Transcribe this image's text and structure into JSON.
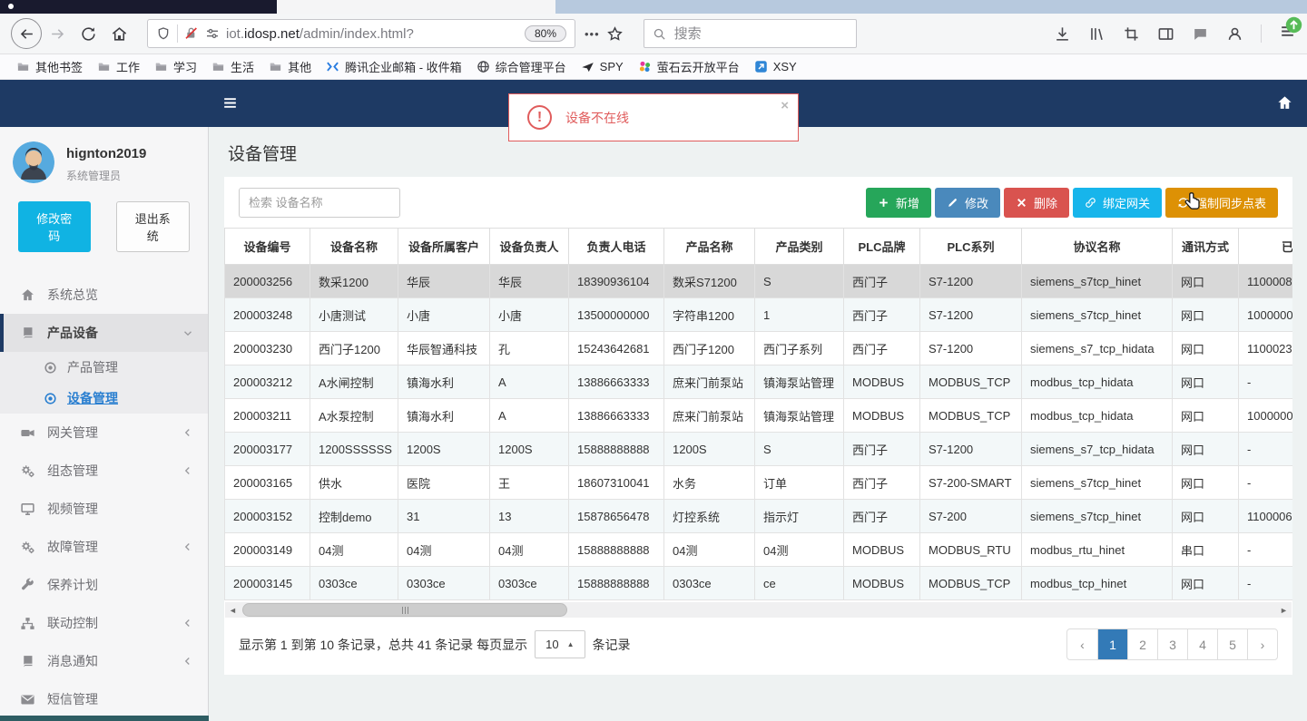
{
  "colors": {
    "navy": "#1e3a64",
    "cyan": "#10b3e3",
    "link": "#2a7fd0",
    "page-active": "#337ab7",
    "alert-red": "#e05c5c",
    "row-selected": "#d8d8d8",
    "row-stripe": "#f3f8f9"
  },
  "browser": {
    "url": {
      "pre": "iot.",
      "host": "idosp.net",
      "path": "/admin/index.html?"
    },
    "zoom_badge": "80%",
    "more_dots": "•••",
    "search_placeholder": "搜索",
    "bookmarks": [
      {
        "icon": "i-folder",
        "label": "其他书签"
      },
      {
        "icon": "i-folder",
        "label": "工作"
      },
      {
        "icon": "i-folder",
        "label": "学习"
      },
      {
        "icon": "i-folder",
        "label": "生活"
      },
      {
        "icon": "i-folder",
        "label": "其他"
      },
      {
        "icon": "fav-tencent",
        "label": "腾讯企业邮箱 - 收件箱"
      },
      {
        "icon": "fav-globe",
        "label": "综合管理平台"
      },
      {
        "icon": "fav-spy",
        "label": "SPY"
      },
      {
        "icon": "fav-ys7",
        "label": "萤石云开放平台"
      },
      {
        "icon": "fav-xsy",
        "label": "XSY"
      }
    ]
  },
  "alert": {
    "text": "设备不在线",
    "close": "×"
  },
  "sidebar": {
    "user": {
      "name": "hignton2019",
      "role": "系统管理员"
    },
    "buttons": {
      "change_password": "修改密码",
      "logout": "退出系统"
    },
    "menu": [
      {
        "id": "system-overview",
        "icon": "i-home-fill",
        "label": "系统总览"
      },
      {
        "id": "product-device",
        "icon": "i-book",
        "label": "产品设备",
        "active": true,
        "chevron": "down"
      },
      {
        "id": "product-manage",
        "icon": "i-dot-circle",
        "label": "产品管理",
        "sub": true
      },
      {
        "id": "device-manage",
        "icon": "i-dot-circle",
        "label": "设备管理",
        "sub": true,
        "current": true
      },
      {
        "id": "gateway-manage",
        "icon": "i-video",
        "label": "网关管理",
        "chevron": "left"
      },
      {
        "id": "hmi-manage",
        "icon": "i-gears",
        "label": "组态管理",
        "chevron": "left"
      },
      {
        "id": "video-manage",
        "icon": "i-monitor",
        "label": "视频管理"
      },
      {
        "id": "fault-manage",
        "icon": "i-gears",
        "label": "故障管理",
        "chevron": "left"
      },
      {
        "id": "maintain-plan",
        "icon": "i-wrench",
        "label": "保养计划"
      },
      {
        "id": "linkage-control",
        "icon": "i-sitemap",
        "label": "联动控制",
        "chevron": "left"
      },
      {
        "id": "message-notify",
        "icon": "i-book",
        "label": "消息通知",
        "chevron": "left"
      },
      {
        "id": "sms-manage",
        "icon": "i-envelope",
        "label": "短信管理"
      }
    ]
  },
  "main": {
    "title": "设备管理",
    "search_placeholder": "检索 设备名称",
    "actions": [
      {
        "id": "add",
        "icon": "i-plus",
        "label": "新增",
        "color": "#26a65a"
      },
      {
        "id": "edit",
        "icon": "i-pencil",
        "label": "修改",
        "color": "#4a89bc"
      },
      {
        "id": "delete",
        "icon": "i-x",
        "label": "删除",
        "color": "#d9534f"
      },
      {
        "id": "bind-gateway",
        "icon": "i-link",
        "label": "绑定网关",
        "color": "#17b5eb"
      },
      {
        "id": "force-sync",
        "icon": "i-refresh",
        "label": "强制同步点表",
        "color": "#dd9105"
      }
    ],
    "table": {
      "columns": [
        "设备编号",
        "设备名称",
        "设备所属客户",
        "设备负责人",
        "负责人电话",
        "产品名称",
        "产品类别",
        "PLC品牌",
        "PLC系列",
        "协议名称",
        "通讯方式",
        "已绑定网关"
      ],
      "selected_row": 0,
      "rows": [
        [
          "200003256",
          "数采1200",
          "华辰",
          "华辰",
          "18390936104",
          "数采S71200",
          "S",
          "西门子",
          "S7-1200",
          "siemens_s7tcp_hinet",
          "网口",
          "1100008"
        ],
        [
          "200003248",
          "小唐测试",
          "小唐",
          "小唐",
          "13500000000",
          "字符串1200",
          "1",
          "西门子",
          "S7-1200",
          "siemens_s7tcp_hinet",
          "网口",
          "1000000"
        ],
        [
          "200003230",
          "西门子1200",
          "华辰智通科技",
          "孔",
          "15243642681",
          "西门子1200",
          "西门子系列",
          "西门子",
          "S7-1200",
          "siemens_s7_tcp_hidata",
          "网口",
          "1100023"
        ],
        [
          "200003212",
          "A水闸控制",
          "镇海水利",
          "A",
          "13886663333",
          "庶来门前泵站",
          "镇海泵站管理",
          "MODBUS",
          "MODBUS_TCP",
          "modbus_tcp_hidata",
          "网口",
          "-"
        ],
        [
          "200003211",
          "A水泵控制",
          "镇海水利",
          "A",
          "13886663333",
          "庶来门前泵站",
          "镇海泵站管理",
          "MODBUS",
          "MODBUS_TCP",
          "modbus_tcp_hidata",
          "网口",
          "1000000"
        ],
        [
          "200003177",
          "1200SSSSSS",
          "1200S",
          "1200S",
          "15888888888",
          "1200S",
          "S",
          "西门子",
          "S7-1200",
          "siemens_s7_tcp_hidata",
          "网口",
          "-"
        ],
        [
          "200003165",
          "供水",
          "医院",
          "王",
          "18607310041",
          "水务",
          "订单",
          "西门子",
          "S7-200-SMART",
          "siemens_s7tcp_hinet",
          "网口",
          "-"
        ],
        [
          "200003152",
          "控制demo",
          "31",
          "13",
          "15878656478",
          "灯控系统",
          "指示灯",
          "西门子",
          "S7-200",
          "siemens_s7tcp_hinet",
          "网口",
          "1100006"
        ],
        [
          "200003149",
          "04测",
          "04测",
          "04测",
          "15888888888",
          "04测",
          "04测",
          "MODBUS",
          "MODBUS_RTU",
          "modbus_rtu_hinet",
          "串口",
          "-"
        ],
        [
          "200003145",
          "0303ce",
          "0303ce",
          "0303ce",
          "15888888888",
          "0303ce",
          "ce",
          "MODBUS",
          "MODBUS_TCP",
          "modbus_tcp_hinet",
          "网口",
          "-"
        ]
      ]
    },
    "pagination": {
      "summary_prefix": "显示第 1 到第 10 条记录，总共 41 条记录 每页显示",
      "page_size": "10",
      "summary_suffix": "条记录",
      "pages": [
        "‹",
        "1",
        "2",
        "3",
        "4",
        "5",
        "›"
      ],
      "active_page": "1"
    }
  }
}
